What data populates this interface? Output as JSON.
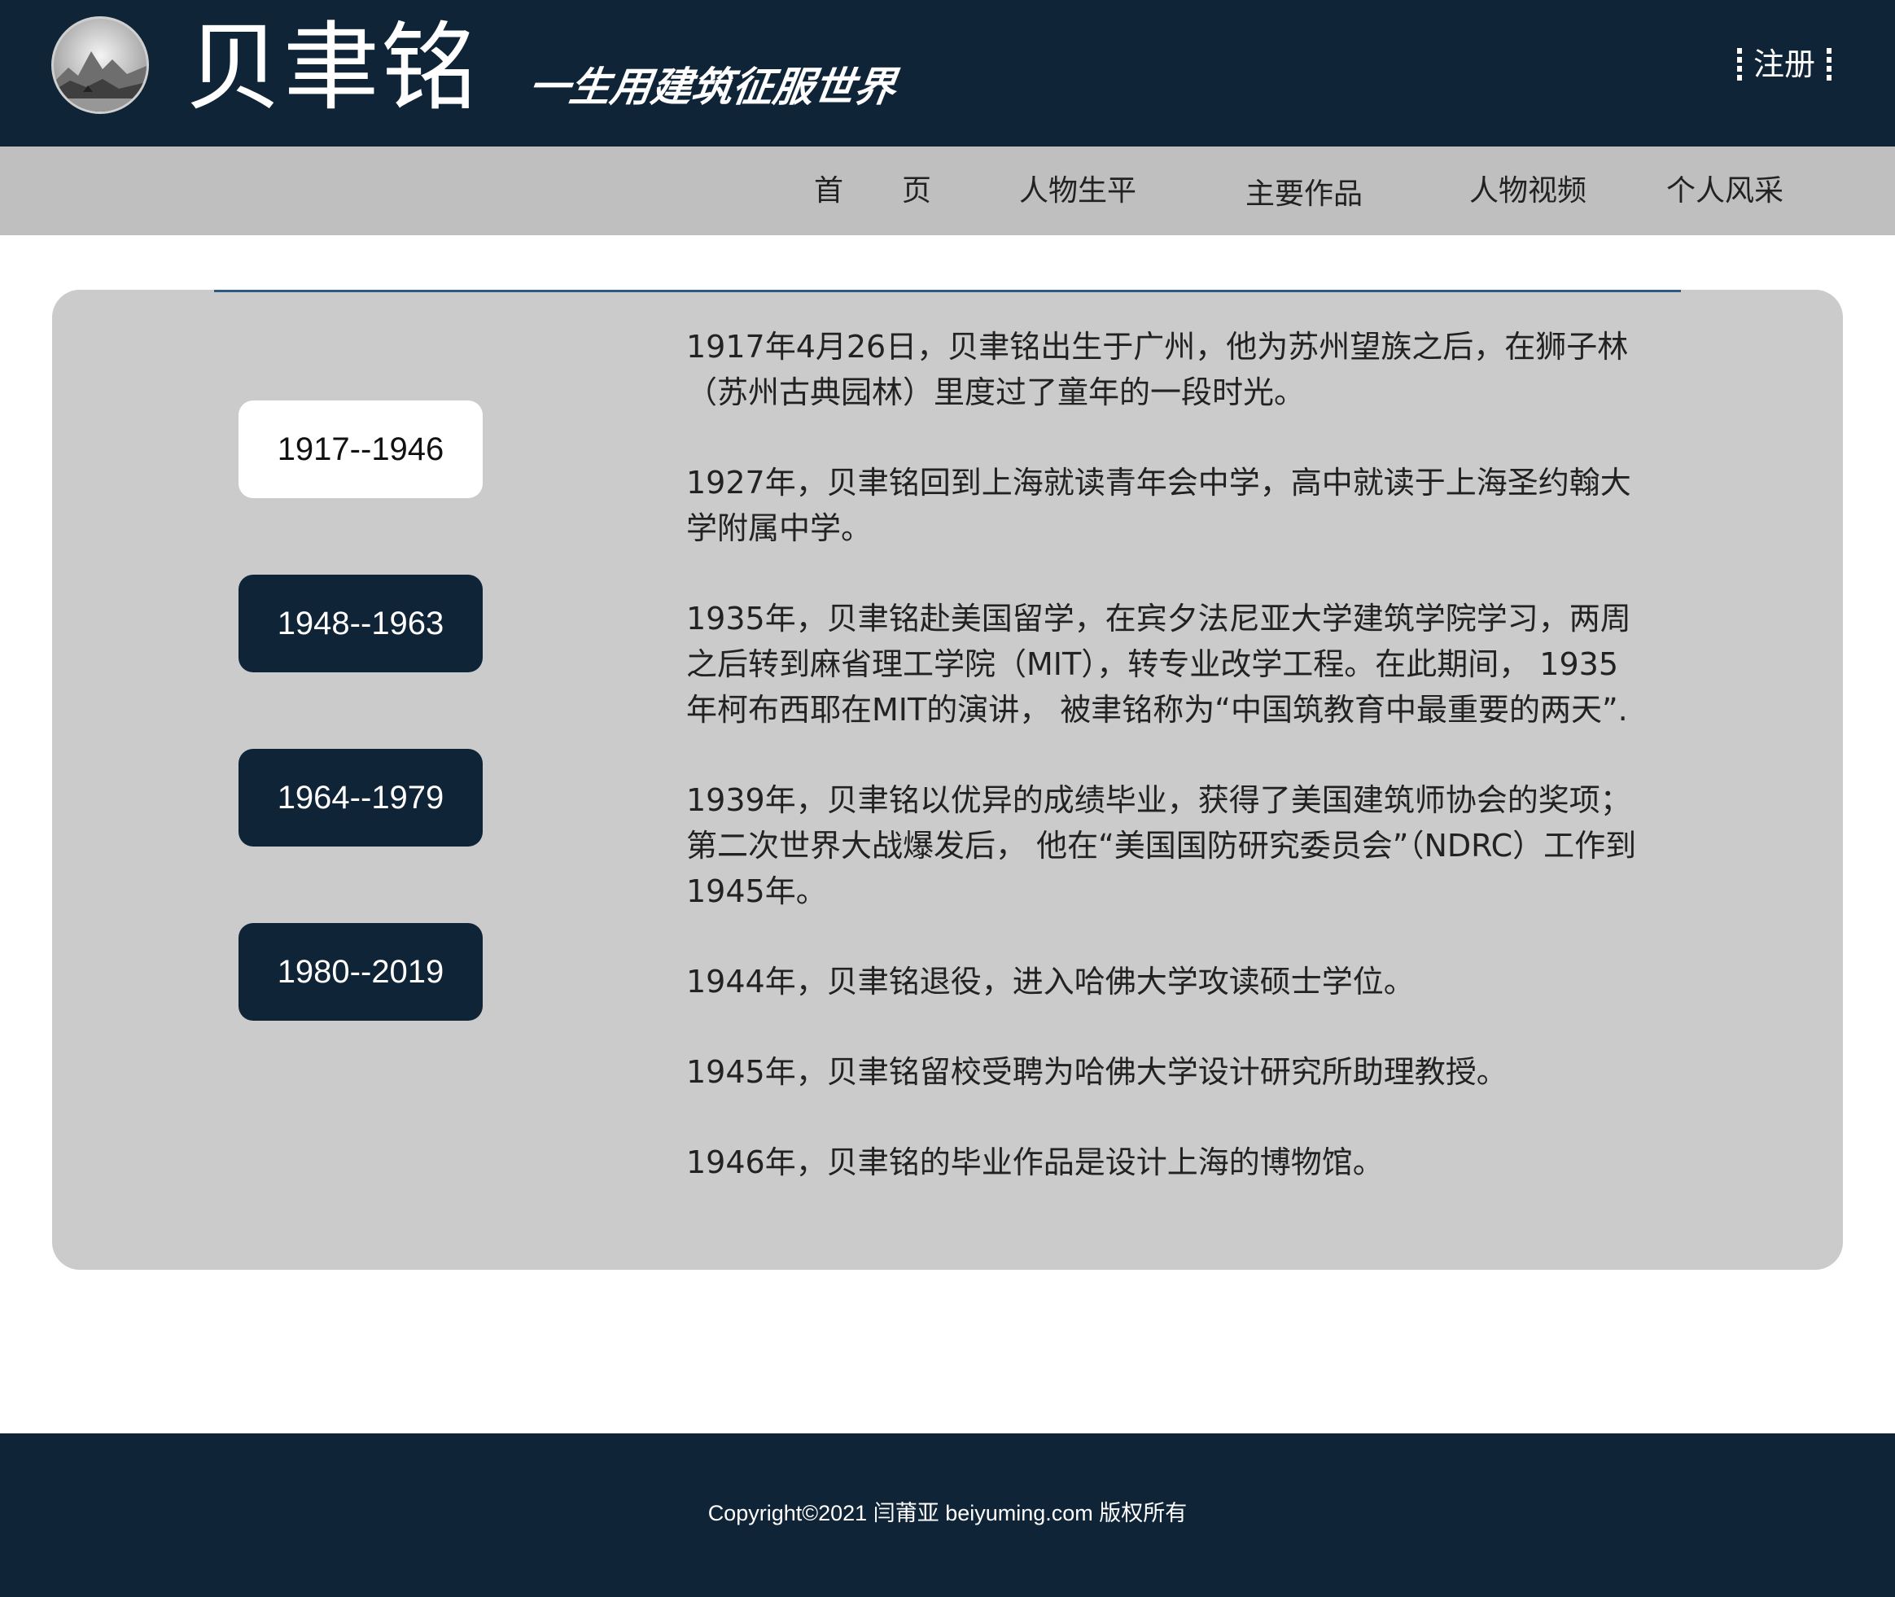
{
  "header": {
    "logo_icon": "landscape-painting-logo",
    "site_name": "贝聿铭",
    "slogan": "一生用建筑征服世界",
    "register_label": "注册"
  },
  "nav": {
    "items": [
      {
        "label": "首　　页"
      },
      {
        "label": "人物生平"
      },
      {
        "label": "主要作品"
      },
      {
        "label": "人物视频"
      },
      {
        "label": "个人风采"
      }
    ]
  },
  "timeline": {
    "periods": [
      {
        "label": "1917--1946",
        "active": true
      },
      {
        "label": "1948--1963",
        "active": false
      },
      {
        "label": "1964--1979",
        "active": false
      },
      {
        "label": "1980--2019",
        "active": false
      }
    ],
    "entries": [
      "1917年4月26日，贝聿铭出生于广州，他为苏州望族之后，在狮子林（苏州古典园林）里度过了童年的一段时光。",
      "1927年，贝聿铭回到上海就读青年会中学，高中就读于上海圣约翰大学附属中学。",
      "1935年，贝聿铭赴美国留学，在宾夕法尼亚大学建筑学院学习，两周之后转到麻省理工学院（MIT），转专业改学工程。在此期间， 1935年柯布西耶在MIT的演讲， 被聿铭称为“中国筑教育中最重要的两天”.",
      "1939年，贝聿铭以优异的成绩毕业，获得了美国建筑师协会的奖项；第二次世界大战爆发后， 他在“美国国防研究委员会”（NDRC）工作到1945年。",
      "1944年，贝聿铭退役，进入哈佛大学攻读硕士学位。",
      "1945年，贝聿铭留校受聘为哈佛大学设计研究所助理教授。",
      "1946年，贝聿铭的毕业作品是设计上海的博物馆。"
    ]
  },
  "footer": {
    "copyright": "Copyright©2021 闫莆亚 beiyuming.com 版权所有"
  },
  "colors": {
    "header_bg": "#0f2437",
    "nav_bg": "#bfbfbf",
    "panel_bg": "#cbcbcb",
    "accent_rule": "#2d5a85",
    "button_bg": "#0f2437",
    "button_active_bg": "#ffffff"
  }
}
